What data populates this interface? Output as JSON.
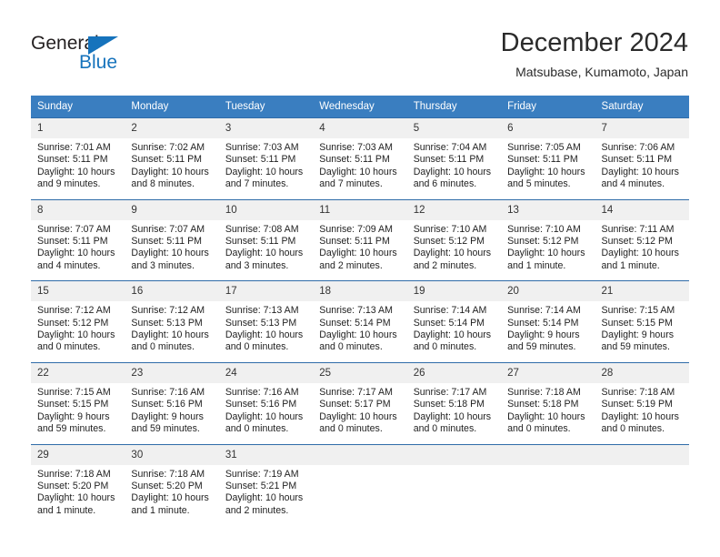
{
  "brand": {
    "name_part1": "General",
    "name_part2": "Blue",
    "logo_icon": "triangle-flag-icon",
    "color_primary": "#1673bc",
    "color_dark": "#231f20"
  },
  "header": {
    "month_title": "December 2024",
    "location": "Matsubase, Kumamoto, Japan"
  },
  "theme": {
    "header_row_bg": "#3a7ec0",
    "header_row_text": "#ffffff",
    "cell_strip_bg": "#f0f0f0",
    "cell_border": "#2f6ca8"
  },
  "weekday_headers": [
    "Sunday",
    "Monday",
    "Tuesday",
    "Wednesday",
    "Thursday",
    "Friday",
    "Saturday"
  ],
  "weeks": [
    [
      {
        "day": "1",
        "sunrise": "Sunrise: 7:01 AM",
        "sunset": "Sunset: 5:11 PM",
        "daylight": "Daylight: 10 hours and 9 minutes."
      },
      {
        "day": "2",
        "sunrise": "Sunrise: 7:02 AM",
        "sunset": "Sunset: 5:11 PM",
        "daylight": "Daylight: 10 hours and 8 minutes."
      },
      {
        "day": "3",
        "sunrise": "Sunrise: 7:03 AM",
        "sunset": "Sunset: 5:11 PM",
        "daylight": "Daylight: 10 hours and 7 minutes."
      },
      {
        "day": "4",
        "sunrise": "Sunrise: 7:03 AM",
        "sunset": "Sunset: 5:11 PM",
        "daylight": "Daylight: 10 hours and 7 minutes."
      },
      {
        "day": "5",
        "sunrise": "Sunrise: 7:04 AM",
        "sunset": "Sunset: 5:11 PM",
        "daylight": "Daylight: 10 hours and 6 minutes."
      },
      {
        "day": "6",
        "sunrise": "Sunrise: 7:05 AM",
        "sunset": "Sunset: 5:11 PM",
        "daylight": "Daylight: 10 hours and 5 minutes."
      },
      {
        "day": "7",
        "sunrise": "Sunrise: 7:06 AM",
        "sunset": "Sunset: 5:11 PM",
        "daylight": "Daylight: 10 hours and 4 minutes."
      }
    ],
    [
      {
        "day": "8",
        "sunrise": "Sunrise: 7:07 AM",
        "sunset": "Sunset: 5:11 PM",
        "daylight": "Daylight: 10 hours and 4 minutes."
      },
      {
        "day": "9",
        "sunrise": "Sunrise: 7:07 AM",
        "sunset": "Sunset: 5:11 PM",
        "daylight": "Daylight: 10 hours and 3 minutes."
      },
      {
        "day": "10",
        "sunrise": "Sunrise: 7:08 AM",
        "sunset": "Sunset: 5:11 PM",
        "daylight": "Daylight: 10 hours and 3 minutes."
      },
      {
        "day": "11",
        "sunrise": "Sunrise: 7:09 AM",
        "sunset": "Sunset: 5:11 PM",
        "daylight": "Daylight: 10 hours and 2 minutes."
      },
      {
        "day": "12",
        "sunrise": "Sunrise: 7:10 AM",
        "sunset": "Sunset: 5:12 PM",
        "daylight": "Daylight: 10 hours and 2 minutes."
      },
      {
        "day": "13",
        "sunrise": "Sunrise: 7:10 AM",
        "sunset": "Sunset: 5:12 PM",
        "daylight": "Daylight: 10 hours and 1 minute."
      },
      {
        "day": "14",
        "sunrise": "Sunrise: 7:11 AM",
        "sunset": "Sunset: 5:12 PM",
        "daylight": "Daylight: 10 hours and 1 minute."
      }
    ],
    [
      {
        "day": "15",
        "sunrise": "Sunrise: 7:12 AM",
        "sunset": "Sunset: 5:12 PM",
        "daylight": "Daylight: 10 hours and 0 minutes."
      },
      {
        "day": "16",
        "sunrise": "Sunrise: 7:12 AM",
        "sunset": "Sunset: 5:13 PM",
        "daylight": "Daylight: 10 hours and 0 minutes."
      },
      {
        "day": "17",
        "sunrise": "Sunrise: 7:13 AM",
        "sunset": "Sunset: 5:13 PM",
        "daylight": "Daylight: 10 hours and 0 minutes."
      },
      {
        "day": "18",
        "sunrise": "Sunrise: 7:13 AM",
        "sunset": "Sunset: 5:14 PM",
        "daylight": "Daylight: 10 hours and 0 minutes."
      },
      {
        "day": "19",
        "sunrise": "Sunrise: 7:14 AM",
        "sunset": "Sunset: 5:14 PM",
        "daylight": "Daylight: 10 hours and 0 minutes."
      },
      {
        "day": "20",
        "sunrise": "Sunrise: 7:14 AM",
        "sunset": "Sunset: 5:14 PM",
        "daylight": "Daylight: 9 hours and 59 minutes."
      },
      {
        "day": "21",
        "sunrise": "Sunrise: 7:15 AM",
        "sunset": "Sunset: 5:15 PM",
        "daylight": "Daylight: 9 hours and 59 minutes."
      }
    ],
    [
      {
        "day": "22",
        "sunrise": "Sunrise: 7:15 AM",
        "sunset": "Sunset: 5:15 PM",
        "daylight": "Daylight: 9 hours and 59 minutes."
      },
      {
        "day": "23",
        "sunrise": "Sunrise: 7:16 AM",
        "sunset": "Sunset: 5:16 PM",
        "daylight": "Daylight: 9 hours and 59 minutes."
      },
      {
        "day": "24",
        "sunrise": "Sunrise: 7:16 AM",
        "sunset": "Sunset: 5:16 PM",
        "daylight": "Daylight: 10 hours and 0 minutes."
      },
      {
        "day": "25",
        "sunrise": "Sunrise: 7:17 AM",
        "sunset": "Sunset: 5:17 PM",
        "daylight": "Daylight: 10 hours and 0 minutes."
      },
      {
        "day": "26",
        "sunrise": "Sunrise: 7:17 AM",
        "sunset": "Sunset: 5:18 PM",
        "daylight": "Daylight: 10 hours and 0 minutes."
      },
      {
        "day": "27",
        "sunrise": "Sunrise: 7:18 AM",
        "sunset": "Sunset: 5:18 PM",
        "daylight": "Daylight: 10 hours and 0 minutes."
      },
      {
        "day": "28",
        "sunrise": "Sunrise: 7:18 AM",
        "sunset": "Sunset: 5:19 PM",
        "daylight": "Daylight: 10 hours and 0 minutes."
      }
    ],
    [
      {
        "day": "29",
        "sunrise": "Sunrise: 7:18 AM",
        "sunset": "Sunset: 5:20 PM",
        "daylight": "Daylight: 10 hours and 1 minute."
      },
      {
        "day": "30",
        "sunrise": "Sunrise: 7:18 AM",
        "sunset": "Sunset: 5:20 PM",
        "daylight": "Daylight: 10 hours and 1 minute."
      },
      {
        "day": "31",
        "sunrise": "Sunrise: 7:19 AM",
        "sunset": "Sunset: 5:21 PM",
        "daylight": "Daylight: 10 hours and 2 minutes."
      },
      {
        "day": "",
        "sunrise": "",
        "sunset": "",
        "daylight": ""
      },
      {
        "day": "",
        "sunrise": "",
        "sunset": "",
        "daylight": ""
      },
      {
        "day": "",
        "sunrise": "",
        "sunset": "",
        "daylight": ""
      },
      {
        "day": "",
        "sunrise": "",
        "sunset": "",
        "daylight": ""
      }
    ]
  ]
}
